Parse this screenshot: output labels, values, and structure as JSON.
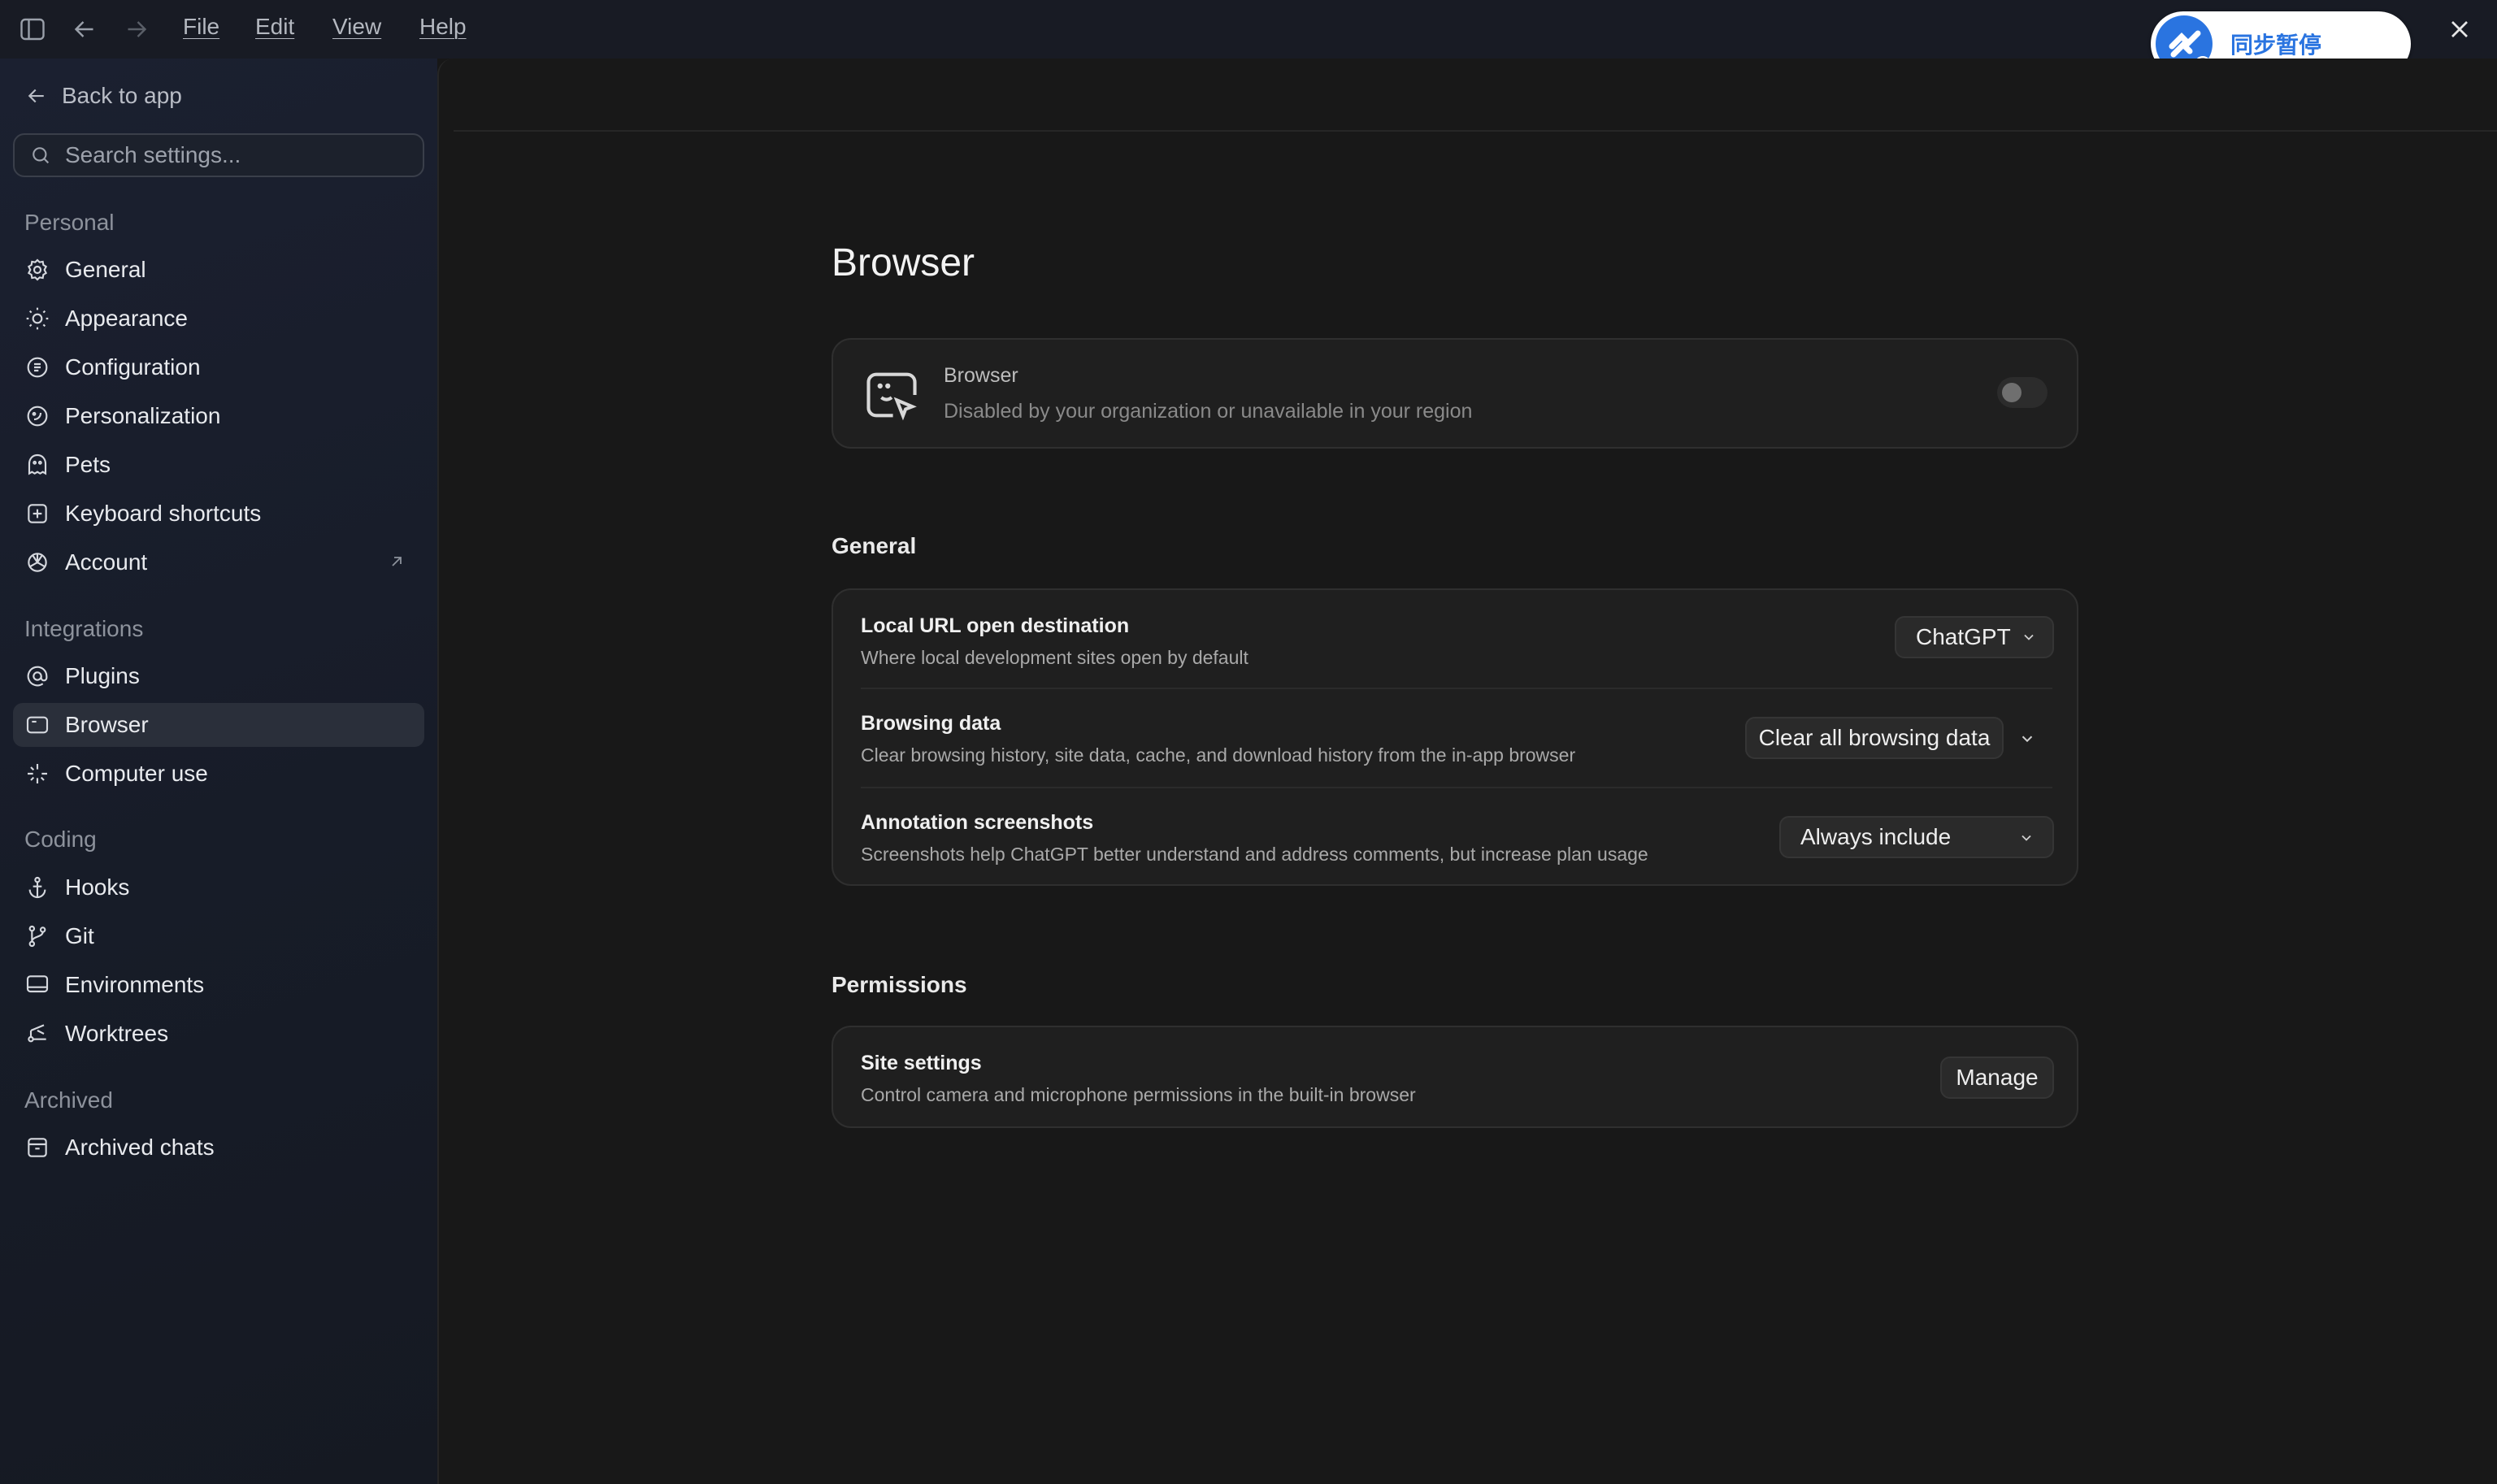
{
  "titlebar": {
    "menus": [
      "File",
      "Edit",
      "View",
      "Help"
    ],
    "sync_badge_text": "同步暂停"
  },
  "sidebar": {
    "back_label": "Back to app",
    "search_placeholder": "Search settings...",
    "sections": [
      {
        "title": "Personal",
        "items": [
          {
            "label": "General",
            "icon": "gear-icon"
          },
          {
            "label": "Appearance",
            "icon": "sun-icon"
          },
          {
            "label": "Configuration",
            "icon": "config-icon"
          },
          {
            "label": "Personalization",
            "icon": "personalization-icon"
          },
          {
            "label": "Pets",
            "icon": "pet-icon"
          },
          {
            "label": "Keyboard shortcuts",
            "icon": "keyboard-icon"
          },
          {
            "label": "Account",
            "icon": "openai-icon",
            "external": true
          }
        ]
      },
      {
        "title": "Integrations",
        "items": [
          {
            "label": "Plugins",
            "icon": "at-icon"
          },
          {
            "label": "Browser",
            "icon": "browser-icon",
            "active": true
          },
          {
            "label": "Computer use",
            "icon": "sparkle-icon"
          }
        ]
      },
      {
        "title": "Coding",
        "items": [
          {
            "label": "Hooks",
            "icon": "anchor-icon"
          },
          {
            "label": "Git",
            "icon": "git-branch-icon"
          },
          {
            "label": "Environments",
            "icon": "monitor-icon"
          },
          {
            "label": "Worktrees",
            "icon": "worktree-icon"
          }
        ]
      },
      {
        "title": "Archived",
        "items": [
          {
            "label": "Archived chats",
            "icon": "archive-icon"
          }
        ]
      }
    ]
  },
  "main": {
    "page_title": "Browser",
    "browser_card": {
      "title": "Browser",
      "description": "Disabled by your organization or unavailable in your region",
      "toggle_on": false
    },
    "general": {
      "heading": "General",
      "rows": [
        {
          "title": "Local URL open destination",
          "description": "Where local development sites open by default",
          "control": "ChatGPT"
        },
        {
          "title": "Browsing data",
          "description": "Clear browsing history, site data, cache, and download history from the in-app browser",
          "control": "Clear all browsing data"
        },
        {
          "title": "Annotation screenshots",
          "description": "Screenshots help ChatGPT better understand and address comments, but increase plan usage",
          "control": "Always include"
        }
      ]
    },
    "permissions": {
      "heading": "Permissions",
      "rows": [
        {
          "title": "Site settings",
          "description": "Control camera and microphone permissions in the built-in browser",
          "control": "Manage"
        }
      ]
    }
  },
  "colors": {
    "sidebar_bg": "#1b2030",
    "main_bg": "#181818",
    "card_bg": "#1f1f1f",
    "active_item_bg": "#2a2f3a",
    "badge_blue": "#2a74e0"
  }
}
